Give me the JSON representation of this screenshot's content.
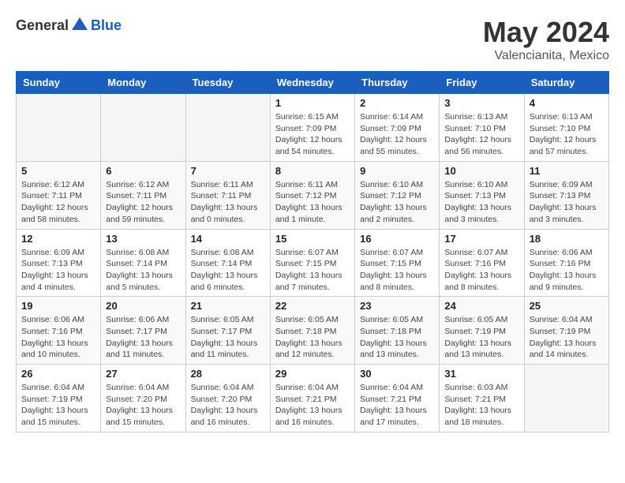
{
  "header": {
    "logo_general": "General",
    "logo_blue": "Blue",
    "month": "May 2024",
    "location": "Valencianita, Mexico"
  },
  "days_of_week": [
    "Sunday",
    "Monday",
    "Tuesday",
    "Wednesday",
    "Thursday",
    "Friday",
    "Saturday"
  ],
  "weeks": [
    [
      {
        "day": "",
        "info": ""
      },
      {
        "day": "",
        "info": ""
      },
      {
        "day": "",
        "info": ""
      },
      {
        "day": "1",
        "info": "Sunrise: 6:15 AM\nSunset: 7:09 PM\nDaylight: 12 hours\nand 54 minutes."
      },
      {
        "day": "2",
        "info": "Sunrise: 6:14 AM\nSunset: 7:09 PM\nDaylight: 12 hours\nand 55 minutes."
      },
      {
        "day": "3",
        "info": "Sunrise: 6:13 AM\nSunset: 7:10 PM\nDaylight: 12 hours\nand 56 minutes."
      },
      {
        "day": "4",
        "info": "Sunrise: 6:13 AM\nSunset: 7:10 PM\nDaylight: 12 hours\nand 57 minutes."
      }
    ],
    [
      {
        "day": "5",
        "info": "Sunrise: 6:12 AM\nSunset: 7:11 PM\nDaylight: 12 hours\nand 58 minutes."
      },
      {
        "day": "6",
        "info": "Sunrise: 6:12 AM\nSunset: 7:11 PM\nDaylight: 12 hours\nand 59 minutes."
      },
      {
        "day": "7",
        "info": "Sunrise: 6:11 AM\nSunset: 7:11 PM\nDaylight: 13 hours\nand 0 minutes."
      },
      {
        "day": "8",
        "info": "Sunrise: 6:11 AM\nSunset: 7:12 PM\nDaylight: 13 hours\nand 1 minute."
      },
      {
        "day": "9",
        "info": "Sunrise: 6:10 AM\nSunset: 7:12 PM\nDaylight: 13 hours\nand 2 minutes."
      },
      {
        "day": "10",
        "info": "Sunrise: 6:10 AM\nSunset: 7:13 PM\nDaylight: 13 hours\nand 3 minutes."
      },
      {
        "day": "11",
        "info": "Sunrise: 6:09 AM\nSunset: 7:13 PM\nDaylight: 13 hours\nand 3 minutes."
      }
    ],
    [
      {
        "day": "12",
        "info": "Sunrise: 6:09 AM\nSunset: 7:13 PM\nDaylight: 13 hours\nand 4 minutes."
      },
      {
        "day": "13",
        "info": "Sunrise: 6:08 AM\nSunset: 7:14 PM\nDaylight: 13 hours\nand 5 minutes."
      },
      {
        "day": "14",
        "info": "Sunrise: 6:08 AM\nSunset: 7:14 PM\nDaylight: 13 hours\nand 6 minutes."
      },
      {
        "day": "15",
        "info": "Sunrise: 6:07 AM\nSunset: 7:15 PM\nDaylight: 13 hours\nand 7 minutes."
      },
      {
        "day": "16",
        "info": "Sunrise: 6:07 AM\nSunset: 7:15 PM\nDaylight: 13 hours\nand 8 minutes."
      },
      {
        "day": "17",
        "info": "Sunrise: 6:07 AM\nSunset: 7:16 PM\nDaylight: 13 hours\nand 8 minutes."
      },
      {
        "day": "18",
        "info": "Sunrise: 6:06 AM\nSunset: 7:16 PM\nDaylight: 13 hours\nand 9 minutes."
      }
    ],
    [
      {
        "day": "19",
        "info": "Sunrise: 6:06 AM\nSunset: 7:16 PM\nDaylight: 13 hours\nand 10 minutes."
      },
      {
        "day": "20",
        "info": "Sunrise: 6:06 AM\nSunset: 7:17 PM\nDaylight: 13 hours\nand 11 minutes."
      },
      {
        "day": "21",
        "info": "Sunrise: 6:05 AM\nSunset: 7:17 PM\nDaylight: 13 hours\nand 11 minutes."
      },
      {
        "day": "22",
        "info": "Sunrise: 6:05 AM\nSunset: 7:18 PM\nDaylight: 13 hours\nand 12 minutes."
      },
      {
        "day": "23",
        "info": "Sunrise: 6:05 AM\nSunset: 7:18 PM\nDaylight: 13 hours\nand 13 minutes."
      },
      {
        "day": "24",
        "info": "Sunrise: 6:05 AM\nSunset: 7:19 PM\nDaylight: 13 hours\nand 13 minutes."
      },
      {
        "day": "25",
        "info": "Sunrise: 6:04 AM\nSunset: 7:19 PM\nDaylight: 13 hours\nand 14 minutes."
      }
    ],
    [
      {
        "day": "26",
        "info": "Sunrise: 6:04 AM\nSunset: 7:19 PM\nDaylight: 13 hours\nand 15 minutes."
      },
      {
        "day": "27",
        "info": "Sunrise: 6:04 AM\nSunset: 7:20 PM\nDaylight: 13 hours\nand 15 minutes."
      },
      {
        "day": "28",
        "info": "Sunrise: 6:04 AM\nSunset: 7:20 PM\nDaylight: 13 hours\nand 16 minutes."
      },
      {
        "day": "29",
        "info": "Sunrise: 6:04 AM\nSunset: 7:21 PM\nDaylight: 13 hours\nand 16 minutes."
      },
      {
        "day": "30",
        "info": "Sunrise: 6:04 AM\nSunset: 7:21 PM\nDaylight: 13 hours\nand 17 minutes."
      },
      {
        "day": "31",
        "info": "Sunrise: 6:03 AM\nSunset: 7:21 PM\nDaylight: 13 hours\nand 18 minutes."
      },
      {
        "day": "",
        "info": ""
      }
    ]
  ]
}
